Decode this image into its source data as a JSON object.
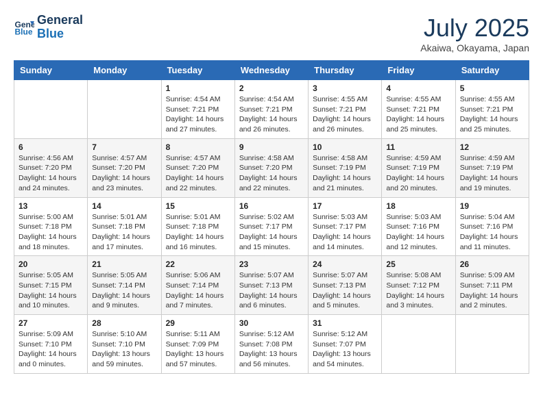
{
  "header": {
    "logo_line1": "General",
    "logo_line2": "Blue",
    "month": "July 2025",
    "location": "Akaiwa, Okayama, Japan"
  },
  "weekdays": [
    "Sunday",
    "Monday",
    "Tuesday",
    "Wednesday",
    "Thursday",
    "Friday",
    "Saturday"
  ],
  "weeks": [
    [
      {
        "day": "",
        "info": ""
      },
      {
        "day": "",
        "info": ""
      },
      {
        "day": "1",
        "info": "Sunrise: 4:54 AM\nSunset: 7:21 PM\nDaylight: 14 hours and 27 minutes."
      },
      {
        "day": "2",
        "info": "Sunrise: 4:54 AM\nSunset: 7:21 PM\nDaylight: 14 hours and 26 minutes."
      },
      {
        "day": "3",
        "info": "Sunrise: 4:55 AM\nSunset: 7:21 PM\nDaylight: 14 hours and 26 minutes."
      },
      {
        "day": "4",
        "info": "Sunrise: 4:55 AM\nSunset: 7:21 PM\nDaylight: 14 hours and 25 minutes."
      },
      {
        "day": "5",
        "info": "Sunrise: 4:55 AM\nSunset: 7:21 PM\nDaylight: 14 hours and 25 minutes."
      }
    ],
    [
      {
        "day": "6",
        "info": "Sunrise: 4:56 AM\nSunset: 7:20 PM\nDaylight: 14 hours and 24 minutes."
      },
      {
        "day": "7",
        "info": "Sunrise: 4:57 AM\nSunset: 7:20 PM\nDaylight: 14 hours and 23 minutes."
      },
      {
        "day": "8",
        "info": "Sunrise: 4:57 AM\nSunset: 7:20 PM\nDaylight: 14 hours and 22 minutes."
      },
      {
        "day": "9",
        "info": "Sunrise: 4:58 AM\nSunset: 7:20 PM\nDaylight: 14 hours and 22 minutes."
      },
      {
        "day": "10",
        "info": "Sunrise: 4:58 AM\nSunset: 7:19 PM\nDaylight: 14 hours and 21 minutes."
      },
      {
        "day": "11",
        "info": "Sunrise: 4:59 AM\nSunset: 7:19 PM\nDaylight: 14 hours and 20 minutes."
      },
      {
        "day": "12",
        "info": "Sunrise: 4:59 AM\nSunset: 7:19 PM\nDaylight: 14 hours and 19 minutes."
      }
    ],
    [
      {
        "day": "13",
        "info": "Sunrise: 5:00 AM\nSunset: 7:18 PM\nDaylight: 14 hours and 18 minutes."
      },
      {
        "day": "14",
        "info": "Sunrise: 5:01 AM\nSunset: 7:18 PM\nDaylight: 14 hours and 17 minutes."
      },
      {
        "day": "15",
        "info": "Sunrise: 5:01 AM\nSunset: 7:18 PM\nDaylight: 14 hours and 16 minutes."
      },
      {
        "day": "16",
        "info": "Sunrise: 5:02 AM\nSunset: 7:17 PM\nDaylight: 14 hours and 15 minutes."
      },
      {
        "day": "17",
        "info": "Sunrise: 5:03 AM\nSunset: 7:17 PM\nDaylight: 14 hours and 14 minutes."
      },
      {
        "day": "18",
        "info": "Sunrise: 5:03 AM\nSunset: 7:16 PM\nDaylight: 14 hours and 12 minutes."
      },
      {
        "day": "19",
        "info": "Sunrise: 5:04 AM\nSunset: 7:16 PM\nDaylight: 14 hours and 11 minutes."
      }
    ],
    [
      {
        "day": "20",
        "info": "Sunrise: 5:05 AM\nSunset: 7:15 PM\nDaylight: 14 hours and 10 minutes."
      },
      {
        "day": "21",
        "info": "Sunrise: 5:05 AM\nSunset: 7:14 PM\nDaylight: 14 hours and 9 minutes."
      },
      {
        "day": "22",
        "info": "Sunrise: 5:06 AM\nSunset: 7:14 PM\nDaylight: 14 hours and 7 minutes."
      },
      {
        "day": "23",
        "info": "Sunrise: 5:07 AM\nSunset: 7:13 PM\nDaylight: 14 hours and 6 minutes."
      },
      {
        "day": "24",
        "info": "Sunrise: 5:07 AM\nSunset: 7:13 PM\nDaylight: 14 hours and 5 minutes."
      },
      {
        "day": "25",
        "info": "Sunrise: 5:08 AM\nSunset: 7:12 PM\nDaylight: 14 hours and 3 minutes."
      },
      {
        "day": "26",
        "info": "Sunrise: 5:09 AM\nSunset: 7:11 PM\nDaylight: 14 hours and 2 minutes."
      }
    ],
    [
      {
        "day": "27",
        "info": "Sunrise: 5:09 AM\nSunset: 7:10 PM\nDaylight: 14 hours and 0 minutes."
      },
      {
        "day": "28",
        "info": "Sunrise: 5:10 AM\nSunset: 7:10 PM\nDaylight: 13 hours and 59 minutes."
      },
      {
        "day": "29",
        "info": "Sunrise: 5:11 AM\nSunset: 7:09 PM\nDaylight: 13 hours and 57 minutes."
      },
      {
        "day": "30",
        "info": "Sunrise: 5:12 AM\nSunset: 7:08 PM\nDaylight: 13 hours and 56 minutes."
      },
      {
        "day": "31",
        "info": "Sunrise: 5:12 AM\nSunset: 7:07 PM\nDaylight: 13 hours and 54 minutes."
      },
      {
        "day": "",
        "info": ""
      },
      {
        "day": "",
        "info": ""
      }
    ]
  ]
}
